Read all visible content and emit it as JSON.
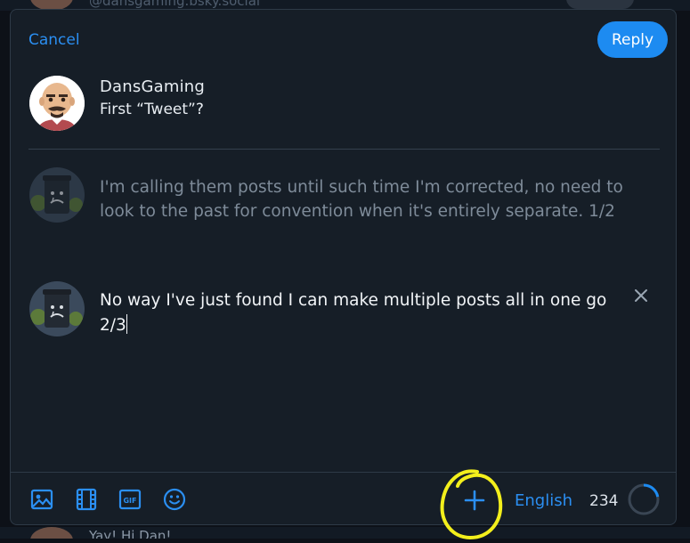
{
  "background": {
    "top_handle": "@dansgaming.bsky.social",
    "bottom_text": "Yay! Hi Dan!"
  },
  "composer": {
    "cancel_label": "Cancel",
    "reply_label": "Reply",
    "parent": {
      "author": "DansGaming",
      "text": "First “Tweet”?"
    },
    "posts": [
      {
        "text": "I'm calling them posts until such time I'm corrected, no need to look to the past for convention when it's entirely separate. 1/2",
        "state": "inactive"
      },
      {
        "text": "No way I've just found I can make multiple posts all in one go 2/3",
        "state": "editing"
      }
    ]
  },
  "toolbar": {
    "icons": [
      "image-icon",
      "video-icon",
      "gif-icon",
      "emoji-icon"
    ],
    "add_post_icon": "plus-icon",
    "language": "English",
    "char_remaining": "234",
    "char_progress": 0.22
  },
  "colors": {
    "accent": "#1d8bf1",
    "link": "#2b8ff2",
    "modal_bg": "#161e27",
    "annotation": "#f3ef1c"
  }
}
